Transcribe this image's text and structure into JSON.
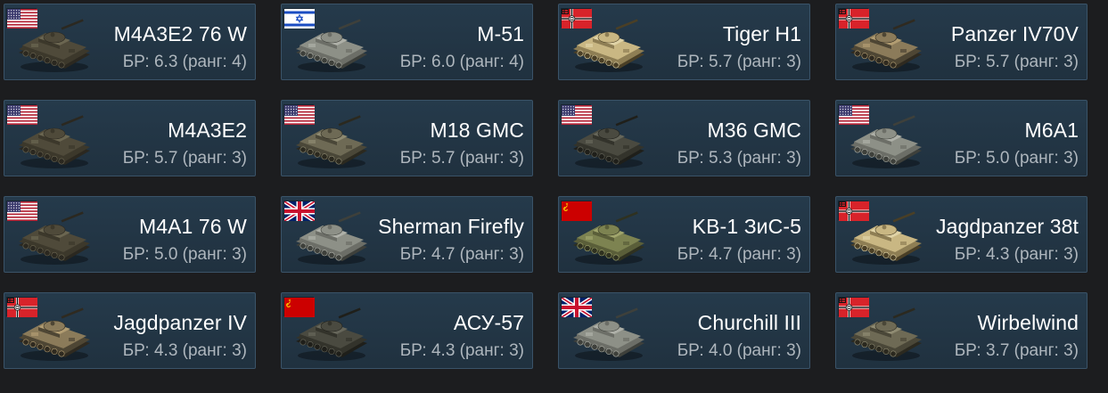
{
  "vehicles": [
    {
      "name": "M4A3E2 76 W",
      "br": "БР: 6.3 (ранг: 4)",
      "flag": "usa",
      "camo": "olive"
    },
    {
      "name": "M-51",
      "br": "БР: 6.0 (ранг: 4)",
      "flag": "israel",
      "camo": "grey"
    },
    {
      "name": "Tiger H1",
      "br": "БР: 5.7 (ранг: 3)",
      "flag": "germany",
      "camo": "desert"
    },
    {
      "name": "Panzer IV70V",
      "br": "БР: 5.7 (ранг: 3)",
      "flag": "germany",
      "camo": "camo"
    },
    {
      "name": "M4A3E2",
      "br": "БР: 5.7 (ранг: 3)",
      "flag": "usa",
      "camo": "olive"
    },
    {
      "name": "M18 GMC",
      "br": "БР: 5.7 (ранг: 3)",
      "flag": "usa",
      "camo": "drab"
    },
    {
      "name": "M36 GMC",
      "br": "БР: 5.3 (ранг: 3)",
      "flag": "usa",
      "camo": "dark"
    },
    {
      "name": "M6A1",
      "br": "БР: 5.0 (ранг: 3)",
      "flag": "usa",
      "camo": "grey"
    },
    {
      "name": "M4A1 76 W",
      "br": "БР: 5.0 (ранг: 3)",
      "flag": "usa",
      "camo": "olive"
    },
    {
      "name": "Sherman Firefly",
      "br": "БР: 4.7 (ранг: 3)",
      "flag": "uk",
      "camo": "grey"
    },
    {
      "name": "KB-1 ЗиС-5",
      "br": "БР: 4.7 (ранг: 3)",
      "flag": "ussr",
      "camo": "green"
    },
    {
      "name": "Jagdpanzer 38t",
      "br": "БР: 4.3 (ранг: 3)",
      "flag": "germany",
      "camo": "desert"
    },
    {
      "name": "Jagdpanzer IV",
      "br": "БР: 4.3 (ранг: 3)",
      "flag": "germany",
      "camo": "camo"
    },
    {
      "name": "АСУ-57",
      "br": "БР: 4.3 (ранг: 3)",
      "flag": "ussr",
      "camo": "dark"
    },
    {
      "name": "Churchill III",
      "br": "БР: 4.0 (ранг: 3)",
      "flag": "uk",
      "camo": "grey"
    },
    {
      "name": "Wirbelwind",
      "br": "БР: 3.7 (ранг: 3)",
      "flag": "germany",
      "camo": "drab"
    }
  ],
  "colors": {
    "card_bg": "#253a4b",
    "card_border": "#3a5368",
    "name": "#ffffff",
    "br": "#aeb6bd"
  }
}
